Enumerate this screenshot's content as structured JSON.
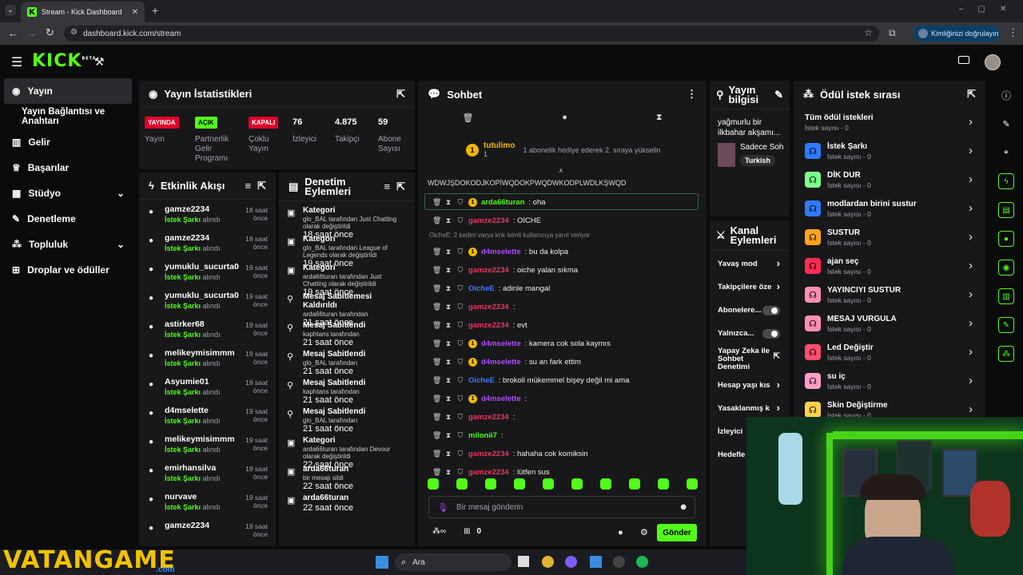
{
  "browser": {
    "tab_title": "Stream - Kick Dashboard",
    "url": "dashboard.kick.com/stream",
    "verify": "Kimliğinizi doğrulayın"
  },
  "header": {
    "logo": "KICK",
    "beta": "BETA"
  },
  "sidebar": {
    "items": [
      {
        "label": "Yayın",
        "active": true
      },
      {
        "label": "Yayın Bağlantısı ve Anahtarı"
      },
      {
        "label": "Gelir"
      },
      {
        "label": "Başarılar"
      },
      {
        "label": "Stüdyo"
      },
      {
        "label": "Denetleme"
      },
      {
        "label": "Topluluk"
      },
      {
        "label": "Droplar ve ödüller"
      }
    ]
  },
  "stats": {
    "title": "Yayın İstatistikleri",
    "badges": [
      {
        "text": "YAYINDA",
        "label": "Yayın",
        "color": "#e0002b"
      },
      {
        "text": "AÇIK",
        "label": "Partnerlik Gelir Programı",
        "color": "#53fc18"
      },
      {
        "text": "KAPALI",
        "label": "Çoklu Yayın",
        "color": "#e0002b"
      }
    ],
    "numbers": [
      {
        "value": "76",
        "label": "İzleyici"
      },
      {
        "value": "4.875",
        "label": "Takipçi"
      },
      {
        "value": "59",
        "label": "Abone Sayısı"
      }
    ]
  },
  "activity": {
    "title": "Etkinlik Akışı",
    "items": [
      {
        "name": "gamze2234",
        "sub": "İstek Şarkı",
        "sub2": "alındı",
        "time": "18 saat önce"
      },
      {
        "name": "gamze2234",
        "sub": "İstek Şarkı",
        "sub2": "alındı",
        "time": "18 saat önce"
      },
      {
        "name": "yumuklu_sucurta0",
        "sub": "İstek Şarkı",
        "sub2": "alındı",
        "time": "19 saat önce"
      },
      {
        "name": "yumuklu_sucurta0",
        "sub": "İstek Şarkı",
        "sub2": "alındı",
        "time": "19 saat önce"
      },
      {
        "name": "astirker68",
        "sub": "İstek Şarkı",
        "sub2": "alındı",
        "time": "19 saat önce"
      },
      {
        "name": "melikeymisimmm",
        "sub": "İstek Şarkı",
        "sub2": "alındı",
        "time": "19 saat önce"
      },
      {
        "name": "Asyumie01",
        "sub": "İstek Şarkı",
        "sub2": "alındı",
        "time": "19 saat önce"
      },
      {
        "name": "d4mselette",
        "sub": "İstek Şarkı",
        "sub2": "alındı",
        "time": "19 saat önce"
      },
      {
        "name": "melikeymisimmm",
        "sub": "İstek Şarkı",
        "sub2": "alındı",
        "time": "19 saat önce"
      },
      {
        "name": "emirhansilva",
        "sub": "İstek Şarkı",
        "sub2": "alındı",
        "time": "19 saat önce"
      },
      {
        "name": "nurvave",
        "sub": "İstek Şarkı",
        "sub2": "alındı",
        "time": "19 saat önce"
      },
      {
        "name": "gamze2234",
        "sub": "",
        "sub2": "",
        "time": "19 saat önce"
      }
    ]
  },
  "moderation": {
    "title": "Denetim Eylemleri",
    "items": [
      {
        "name": "Kategori",
        "l1": "glo_BAL tarafından Just Chatting",
        "l2": "olarak değiştirildi",
        "time": "18 saat önce"
      },
      {
        "name": "Kategori",
        "l1": "glo_BAL tarafından League of",
        "l2": "Legends olarak değiştirildi",
        "time": "19 saat önce"
      },
      {
        "name": "Kategori",
        "l1": "arda66turan tarafından Just",
        "l2": "Chatting olarak değiştirildi",
        "time": "19 saat önce"
      },
      {
        "name": "Mesaj Sabitlemesi Kaldırıldı",
        "l1": "arda66turan tarafından",
        "l2": "",
        "time": "21 saat önce"
      },
      {
        "name": "Mesaj Sabitlendi",
        "l1": "kaphtans tarafından",
        "l2": "",
        "time": "21 saat önce"
      },
      {
        "name": "Mesaj Sabitlendi",
        "l1": "glo_BAL tarafından",
        "l2": "",
        "time": "21 saat önce"
      },
      {
        "name": "Mesaj Sabitlendi",
        "l1": "kaphtans tarafından",
        "l2": "",
        "time": "21 saat önce"
      },
      {
        "name": "Mesaj Sabitlendi",
        "l1": "glo_BAL tarafından",
        "l2": "",
        "time": "21 saat önce"
      },
      {
        "name": "Kategori",
        "l1": "arda66turan tarafından Devour",
        "l2": "olarak değiştirildi",
        "time": "22 saat önce"
      },
      {
        "name": "arda66turan",
        "l1": "bir mesajı sildi",
        "l2": "",
        "time": "22 saat önce"
      },
      {
        "name": "arda66turan",
        "l1": "",
        "l2": "",
        "time": "22 saat önce"
      }
    ]
  },
  "chat": {
    "title": "Sohbet",
    "gift_user": "tutulimo",
    "gift_count": "1",
    "gift_text": "1 abonelik hediye ederek 2. sıraya yükselin",
    "pinned": "WDWJŞDOKODJKOPİWQDOKPWQDWKODPLWDLKŞWQD",
    "reply_note": "OicheE: 2 kedim varya knk isimli kullanıcıya yanıt veriyor",
    "messages": [
      {
        "user": "arda66turan",
        "color": "#53fc18",
        "text": ": oha"
      },
      {
        "user": "gamze2234",
        "color": "#e9365a",
        "text": ": OICHE"
      },
      {
        "user": "d4mselette",
        "color": "#b04cff",
        "text": ": bu da kolpa"
      },
      {
        "user": "gamze2234",
        "color": "#e9365a",
        "text": ": oiche yalan sıkma"
      },
      {
        "user": "OicheE",
        "color": "#3d7bff",
        "text": ": adinle mangal"
      },
      {
        "user": "gamze2234",
        "color": "#e9365a",
        "text": ":"
      },
      {
        "user": "gamze2234",
        "color": "#e9365a",
        "text": ": evt"
      },
      {
        "user": "d4mselette",
        "color": "#b04cff",
        "text": ": kamera cok sola kaymıs"
      },
      {
        "user": "d4mselette",
        "color": "#b04cff",
        "text": ": su an fark ettim"
      },
      {
        "user": "OicheE",
        "color": "#3d7bff",
        "text": ": brokoli mükemmel bişey değil mi ama"
      },
      {
        "user": "d4mselette",
        "color": "#b04cff",
        "text": ":"
      },
      {
        "user": "gamze2234",
        "color": "#e9365a",
        "text": ":"
      },
      {
        "user": "milonii7",
        "color": "#53fc18",
        "text": ":"
      },
      {
        "user": "gamze2234",
        "color": "#e9365a",
        "text": ": hahaha cok komiksin"
      },
      {
        "user": "gamze2234",
        "color": "#e9365a",
        "text": ": lütfen sus"
      }
    ],
    "input_placeholder": "Bir mesaj gönderin",
    "points": "0",
    "send": "Gönder"
  },
  "streaminfo": {
    "title": "Yayın bilgisi",
    "stream_title": "yağmurlu bir ilkbahar akşamı...",
    "category": "Sadece Soh",
    "language": "Turkish"
  },
  "channel_actions": {
    "title": "Kanal Eylemleri",
    "items": [
      {
        "label": "Yavaş mod"
      },
      {
        "label": "Takipçilere öze"
      },
      {
        "label": "Abonelere..."
      },
      {
        "label": "Yalnızca..."
      },
      {
        "label": "Yapay Zeka ile Sohbet Denetimi"
      },
      {
        "label": "Hesap yaşı kıs"
      },
      {
        "label": "Yasaklanmış k"
      },
      {
        "label": "İzleyici"
      },
      {
        "label": "Hedefle"
      }
    ]
  },
  "rewards": {
    "title": "Ödül istek sırası",
    "items": [
      {
        "name": "Tüm ödül istekleri",
        "count": "İstek sayısı - 0",
        "color": ""
      },
      {
        "name": "İstek Şarkı",
        "count": "İstek sayısı - 0",
        "color": "#2f7bff"
      },
      {
        "name": "DİK DUR",
        "count": "İstek sayısı - 0",
        "color": "#7dff8a"
      },
      {
        "name": "modlardan birini sustur",
        "count": "İstek sayısı - 0",
        "color": "#2f7bff"
      },
      {
        "name": "SUSTUR",
        "count": "İstek sayısı - 0",
        "color": "#ffa41b"
      },
      {
        "name": "ajan seç",
        "count": "İstek sayısı - 0",
        "color": "#ff2d55"
      },
      {
        "name": "YAYINCIYI SUSTUR",
        "count": "İstek sayısı - 0",
        "color": "#ff8fb1"
      },
      {
        "name": "MESAJ VURGULA",
        "count": "İstek sayısı - 0",
        "color": "#ff8fb1"
      },
      {
        "name": "Led Değiştir",
        "count": "İstek sayısı - 0",
        "color": "#ff4d6d"
      },
      {
        "name": "su iç",
        "count": "İstek sayısı - 0",
        "color": "#ff9ec7"
      },
      {
        "name": "Skin Değiştirme",
        "count": "İstek sayısı - 0",
        "color": "#ffd24d"
      }
    ]
  },
  "taskbar": {
    "search": "Ara",
    "watermark": "VATANGAME",
    "watermark_sub": ".com"
  }
}
